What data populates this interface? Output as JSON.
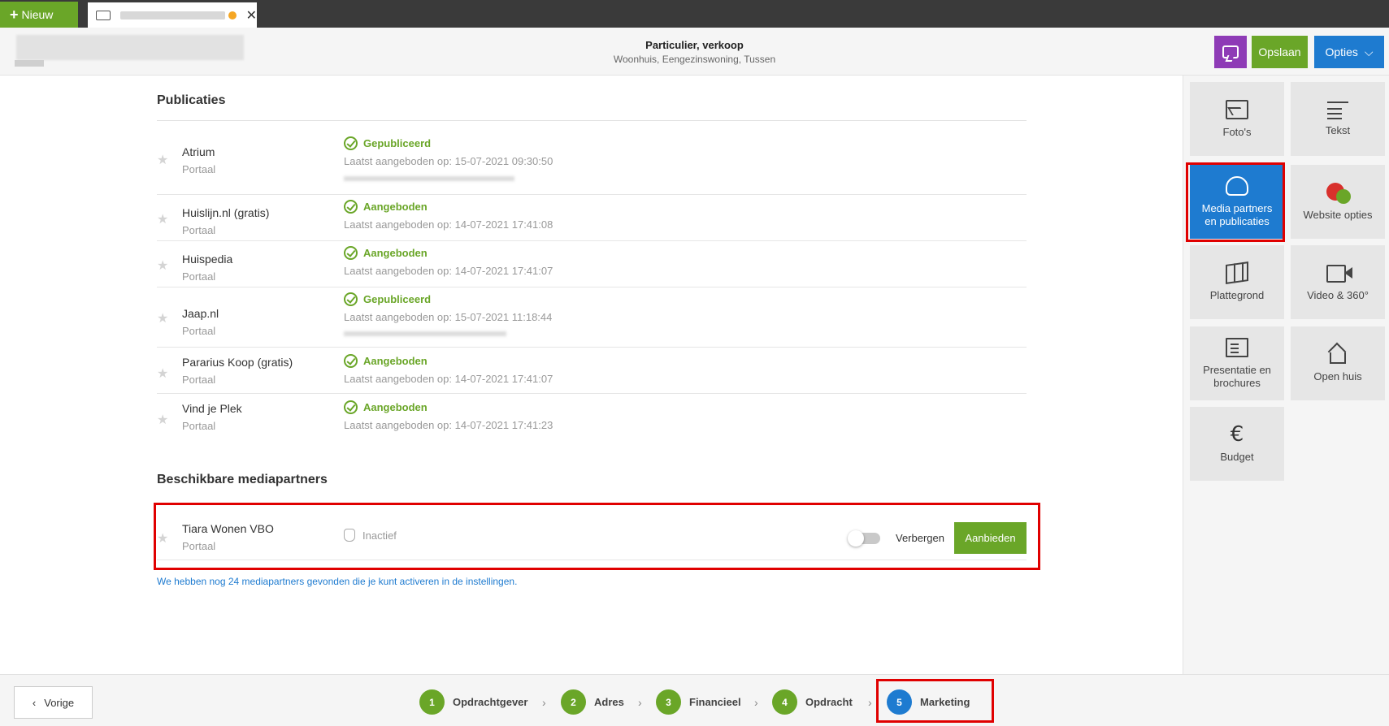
{
  "top_tabs": {
    "new_label": "Nieuw",
    "plus_glyph": "+",
    "close_glyph": "✕"
  },
  "header": {
    "title": "Particulier, verkoop",
    "subtitle": "Woonhuis, Eengezinswoning, Tussen",
    "save_label": "Opslaan",
    "options_label": "Opties",
    "chevron_glyph": "⌵"
  },
  "publications": {
    "title": "Publicaties",
    "items": [
      {
        "name": "Atrium",
        "type": "Portaal",
        "status": "Gepubliceerd",
        "date": "Laatst aangeboden op: 15-07-2021 09:30:50"
      },
      {
        "name": "Huislijn.nl (gratis)",
        "type": "Portaal",
        "status": "Aangeboden",
        "date": "Laatst aangeboden op: 14-07-2021 17:41:08"
      },
      {
        "name": "Huispedia",
        "type": "Portaal",
        "status": "Aangeboden",
        "date": "Laatst aangeboden op: 14-07-2021 17:41:07"
      },
      {
        "name": "Jaap.nl",
        "type": "Portaal",
        "status": "Gepubliceerd",
        "date": "Laatst aangeboden op: 15-07-2021 11:18:44"
      },
      {
        "name": "Pararius Koop (gratis)",
        "type": "Portaal",
        "status": "Aangeboden",
        "date": "Laatst aangeboden op: 14-07-2021 17:41:07"
      },
      {
        "name": "Vind je Plek",
        "type": "Portaal",
        "status": "Aangeboden",
        "date": "Laatst aangeboden op: 14-07-2021 17:41:23"
      }
    ]
  },
  "media_partners": {
    "title": "Beschikbare mediapartners",
    "partner": {
      "name": "Tiara Wonen VBO",
      "type": "Portaal",
      "status": "Inactief"
    },
    "hide_label": "Verbergen",
    "offer_label": "Aanbieden",
    "info_text": "We hebben nog 24 mediapartners gevonden die je kunt activeren in de instellingen."
  },
  "sidebar": {
    "tiles": [
      {
        "label": "Foto's",
        "icon": "photo-icon"
      },
      {
        "label": "Tekst",
        "icon": "text-icon"
      },
      {
        "label": "Media partners en publicaties",
        "icon": "cloud-icon",
        "active": true
      },
      {
        "label": "Website opties",
        "icon": "website-icon"
      },
      {
        "label": "Plattegrond",
        "icon": "map-icon"
      },
      {
        "label": "Video & 360°",
        "icon": "video-icon"
      },
      {
        "label": "Presentatie en brochures",
        "icon": "book-icon"
      },
      {
        "label": "Open huis",
        "icon": "house-icon"
      },
      {
        "label": "Budget",
        "icon": "euro-icon"
      }
    ],
    "euro_glyph": "€"
  },
  "footer": {
    "prev_label": "Vorige",
    "prev_glyph": "‹",
    "steps": [
      {
        "num": "1",
        "label": "Opdrachtgever"
      },
      {
        "num": "2",
        "label": "Adres"
      },
      {
        "num": "3",
        "label": "Financieel"
      },
      {
        "num": "4",
        "label": "Opdracht"
      },
      {
        "num": "5",
        "label": "Marketing",
        "current": true
      }
    ],
    "separator_glyph": "›"
  },
  "colors": {
    "green": "#6aa628",
    "blue": "#1e7bd0",
    "purple": "#8e3bb6",
    "highlight_red": "#e00000"
  }
}
